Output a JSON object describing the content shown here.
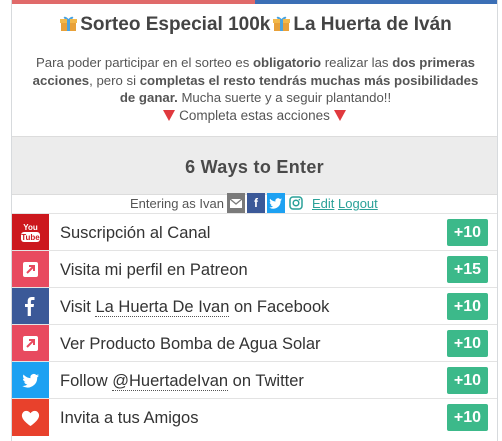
{
  "header": {
    "title_part1": "Sorteo Especial 100k",
    "title_part2": "La Huerta de Iván",
    "desc_p1": "Para poder participar en el sorteo es ",
    "desc_b1": "obligatorio",
    "desc_p2": " realizar las ",
    "desc_b2": "dos primeras acciones",
    "desc_p3": ",  pero si ",
    "desc_b3": "completas el resto tendrás muchas más posibilidades de ganar.",
    "desc_p4": " Mucha suerte y a seguir plantando!!",
    "complete_text": "Completa estas acciones"
  },
  "ways": {
    "title": "6 Ways to Enter"
  },
  "entering": {
    "label": "Entering as Ivan",
    "edit": "Edit",
    "logout": "Logout",
    "fb_glyph": "f",
    "icons": [
      "mail-icon",
      "facebook-icon",
      "twitter-icon",
      "instagram-icon"
    ]
  },
  "entries": [
    {
      "icon": "youtube-icon",
      "label": "Suscripción al Canal",
      "points": "+10",
      "color": "#cc181e"
    },
    {
      "icon": "link-arrow-icon",
      "label": "Visita mi perfil en Patreon",
      "points": "+15",
      "color": "#e84a5f"
    },
    {
      "icon": "facebook-icon",
      "label_pre": "Visit ",
      "label_link": "La Huerta De Ivan",
      "label_post": " on Facebook",
      "points": "+10",
      "color": "#3b5998"
    },
    {
      "icon": "link-arrow-icon",
      "label": "Ver Producto Bomba de Agua Solar",
      "points": "+10",
      "color": "#e84a5f"
    },
    {
      "icon": "twitter-icon",
      "label_pre": "Follow ",
      "label_link": "@HuertadeIvan",
      "label_post": " on Twitter",
      "points": "+10",
      "color": "#1da1f2"
    },
    {
      "icon": "heart-icon",
      "label": "Invita a tus Amigos",
      "points": "+10",
      "color": "#e8412c"
    }
  ],
  "colors": {
    "points_badge": "#3cb98a",
    "link": "#2aa198",
    "topbar_left": "#e06a6a",
    "topbar_right": "#3b6fb6"
  }
}
